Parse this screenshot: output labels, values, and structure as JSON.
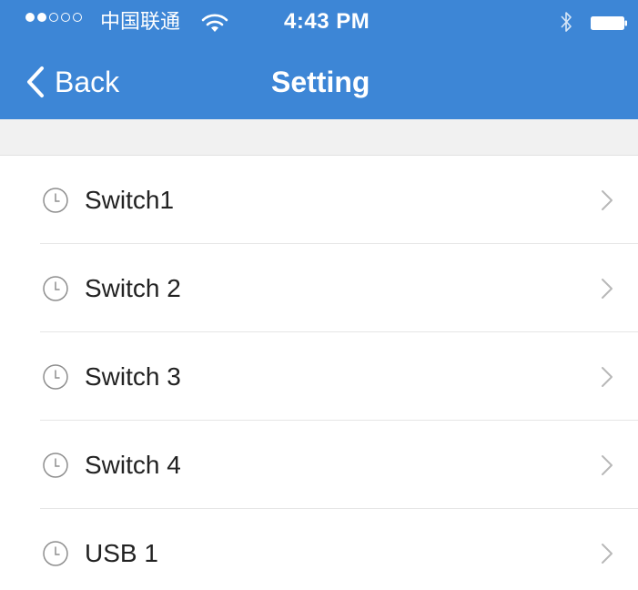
{
  "status_bar": {
    "carrier": "中国联通",
    "time": "4:43 PM",
    "signal_bars_full": 2,
    "signal_bars_total": 5
  },
  "nav": {
    "back_label": "Back",
    "title": "Setting"
  },
  "list": {
    "items": [
      {
        "label": "Switch1",
        "icon": "clock-icon"
      },
      {
        "label": "Switch 2",
        "icon": "clock-icon"
      },
      {
        "label": "Switch 3",
        "icon": "clock-icon"
      },
      {
        "label": "Switch 4",
        "icon": "clock-icon"
      },
      {
        "label": "USB 1",
        "icon": "clock-icon"
      }
    ]
  },
  "colors": {
    "header_bg": "#3d86d6",
    "band_bg": "#f1f1f1",
    "text": "#222222",
    "icon_gray": "#8e8e8e",
    "chevron_gray": "#b8b8b8"
  }
}
